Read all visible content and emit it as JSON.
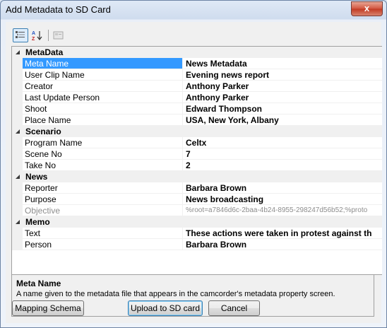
{
  "window": {
    "title": "Add Metadata to SD Card",
    "close_glyph": "x"
  },
  "toolbar": {
    "icons": [
      "categorized-icon",
      "alphabetical-sort-icon",
      "property-pages-icon"
    ]
  },
  "grid": {
    "categories": [
      {
        "label": "MetaData",
        "rows": [
          {
            "name": "Meta Name",
            "value": "News Metadata",
            "selected": true
          },
          {
            "name": "User Clip Name",
            "value": "Evening news report"
          },
          {
            "name": "Creator",
            "value": "Anthony Parker"
          },
          {
            "name": "Last Update Person",
            "value": "Anthony Parker"
          },
          {
            "name": "Shoot",
            "value": "Edward Thompson"
          },
          {
            "name": "Place Name",
            "value": "USA, New York, Albany"
          }
        ]
      },
      {
        "label": "Scenario",
        "rows": [
          {
            "name": "Program Name",
            "value": "Celtx"
          },
          {
            "name": "Scene No",
            "value": "7"
          },
          {
            "name": "Take No",
            "value": "2"
          }
        ]
      },
      {
        "label": "News",
        "rows": [
          {
            "name": "Reporter",
            "value": "Barbara Brown"
          },
          {
            "name": "Purpose",
            "value": "News broadcasting"
          },
          {
            "name": "Objective",
            "value": "%root=a7846d6c-2baa-4b24-8955-298247d56b52;%proto",
            "disabled": true
          }
        ]
      },
      {
        "label": "Memo",
        "rows": [
          {
            "name": "Text",
            "value": "These actions were taken in protest against th"
          },
          {
            "name": "Person",
            "value": "Barbara Brown"
          }
        ]
      }
    ]
  },
  "help": {
    "title": "Meta Name",
    "description": "A name given to the metadata file that appears in the camcorder's metadata property screen."
  },
  "buttons": {
    "mapping_schema": "Mapping Schema",
    "upload": "Upload to SD card",
    "cancel": "Cancel"
  },
  "colors": {
    "selection": "#3399ff",
    "titlebar": "#dfe9f6",
    "close": "#c13a22"
  }
}
